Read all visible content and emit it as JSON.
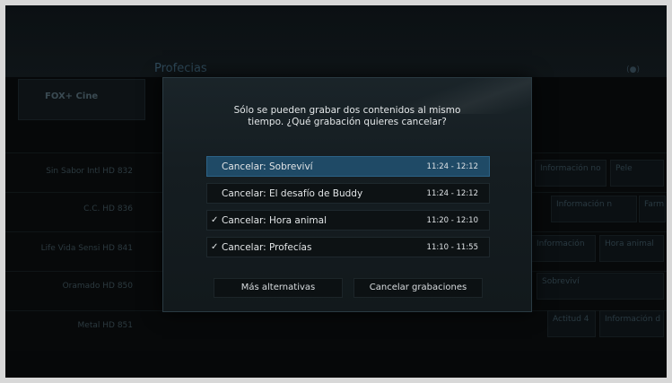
{
  "background": {
    "header_title": "Profecias",
    "header_right": "(●)",
    "logo": "FOX+ Cine",
    "channels": [
      {
        "name": "Sin Sabor Intl HD",
        "number": "832"
      },
      {
        "name": "C.C. HD",
        "number": "836"
      },
      {
        "name": "Life Vida Sensi HD",
        "number": "841"
      },
      {
        "name": "Oramado HD",
        "number": "850"
      },
      {
        "name": "Metal HD",
        "number": "851"
      }
    ],
    "cells": [
      {
        "text": "Información no"
      },
      {
        "text": "Pele"
      },
      {
        "text": "Información n"
      },
      {
        "text": "Farm"
      },
      {
        "text": "Información"
      },
      {
        "text": "Hora animal"
      },
      {
        "text": "Sobreviví"
      },
      {
        "text": "Actitud 4"
      },
      {
        "text": "Información d"
      }
    ]
  },
  "dialog": {
    "message_line1": "Sólo se pueden grabar dos contenidos al mismo",
    "message_line2": "tiempo. ¿Qué grabación quieres cancelar?",
    "options": [
      {
        "check": "",
        "label": "Cancelar: Sobreviví",
        "time": "11:24 - 12:12",
        "selected": true
      },
      {
        "check": "",
        "label": "Cancelar: El desafío de Buddy",
        "time": "11:24 - 12:12",
        "selected": false
      },
      {
        "check": "✓",
        "label": "Cancelar: Hora animal",
        "time": "11:20 - 12:10",
        "selected": false
      },
      {
        "check": "✓",
        "label": "Cancelar: Profecías",
        "time": "11:10 - 11:55",
        "selected": false
      }
    ],
    "buttons": {
      "more": "Más alternativas",
      "cancel": "Cancelar grabaciones"
    }
  }
}
